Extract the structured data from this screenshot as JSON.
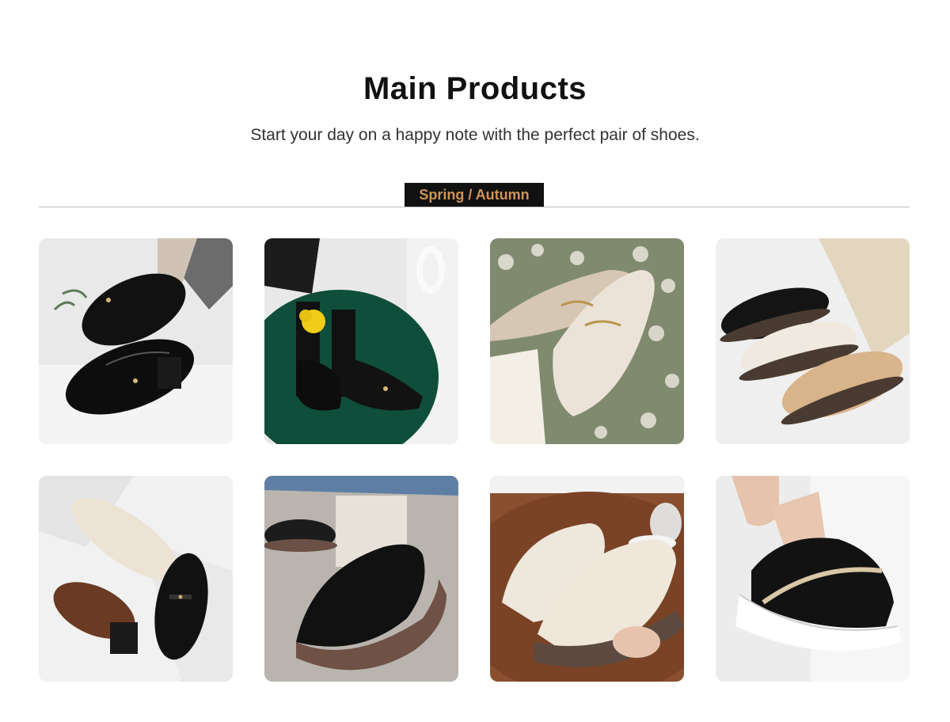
{
  "section": {
    "title": "Main Products",
    "subtitle": "Start your day on a happy note with the perfect pair of shoes."
  },
  "tabs": [
    {
      "label": "Spring / Autumn",
      "active": true
    }
  ],
  "colors": {
    "tab_bg": "#111111",
    "tab_text": "#d19355",
    "divider": "#bdbdbd"
  },
  "products": [
    {
      "image": "black-patent-loafer-photo"
    },
    {
      "image": "black-penny-loafer-green-seat-photo"
    },
    {
      "image": "cream-horsebit-loafer-flowers-photo"
    },
    {
      "image": "three-slip-on-shoes-photo"
    },
    {
      "image": "cream-and-brown-loafers-photo"
    },
    {
      "image": "black-slip-on-wedge-photo"
    },
    {
      "image": "cream-sneaker-on-table-photo"
    },
    {
      "image": "black-platform-sneaker-photo"
    }
  ]
}
